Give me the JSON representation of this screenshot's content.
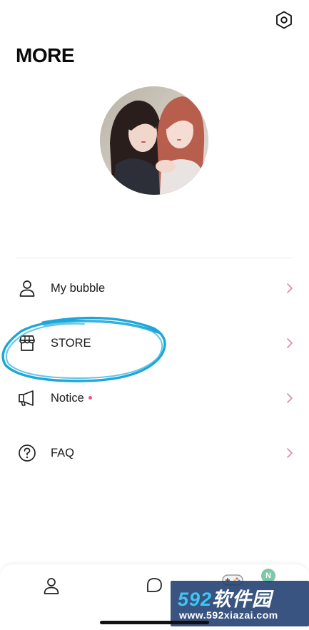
{
  "header": {
    "title": "MORE",
    "settings_icon": "gear-icon"
  },
  "profile": {
    "avatar_alt": "profile photo of two people"
  },
  "menu": {
    "items": [
      {
        "label": "My bubble",
        "icon": "person-icon",
        "has_dot": false
      },
      {
        "label": "STORE",
        "icon": "store-icon",
        "has_dot": false
      },
      {
        "label": "Notice",
        "icon": "megaphone-icon",
        "has_dot": true
      },
      {
        "label": "FAQ",
        "icon": "question-circle-icon",
        "has_dot": false
      }
    ],
    "chevron_color": "#e08aa0",
    "dot_color": "#f0567c"
  },
  "annotation": {
    "color": "#1ea6d8",
    "target": "STORE"
  },
  "bottom_nav": {
    "items": [
      {
        "icon": "person-icon"
      },
      {
        "icon": "chat-bubble-icon"
      },
      {
        "icon": "game-controller-icon"
      }
    ],
    "badge": "N"
  },
  "watermark": {
    "brand_num": "592",
    "brand_text": "软件园",
    "url": "www.592xiazai.com"
  }
}
